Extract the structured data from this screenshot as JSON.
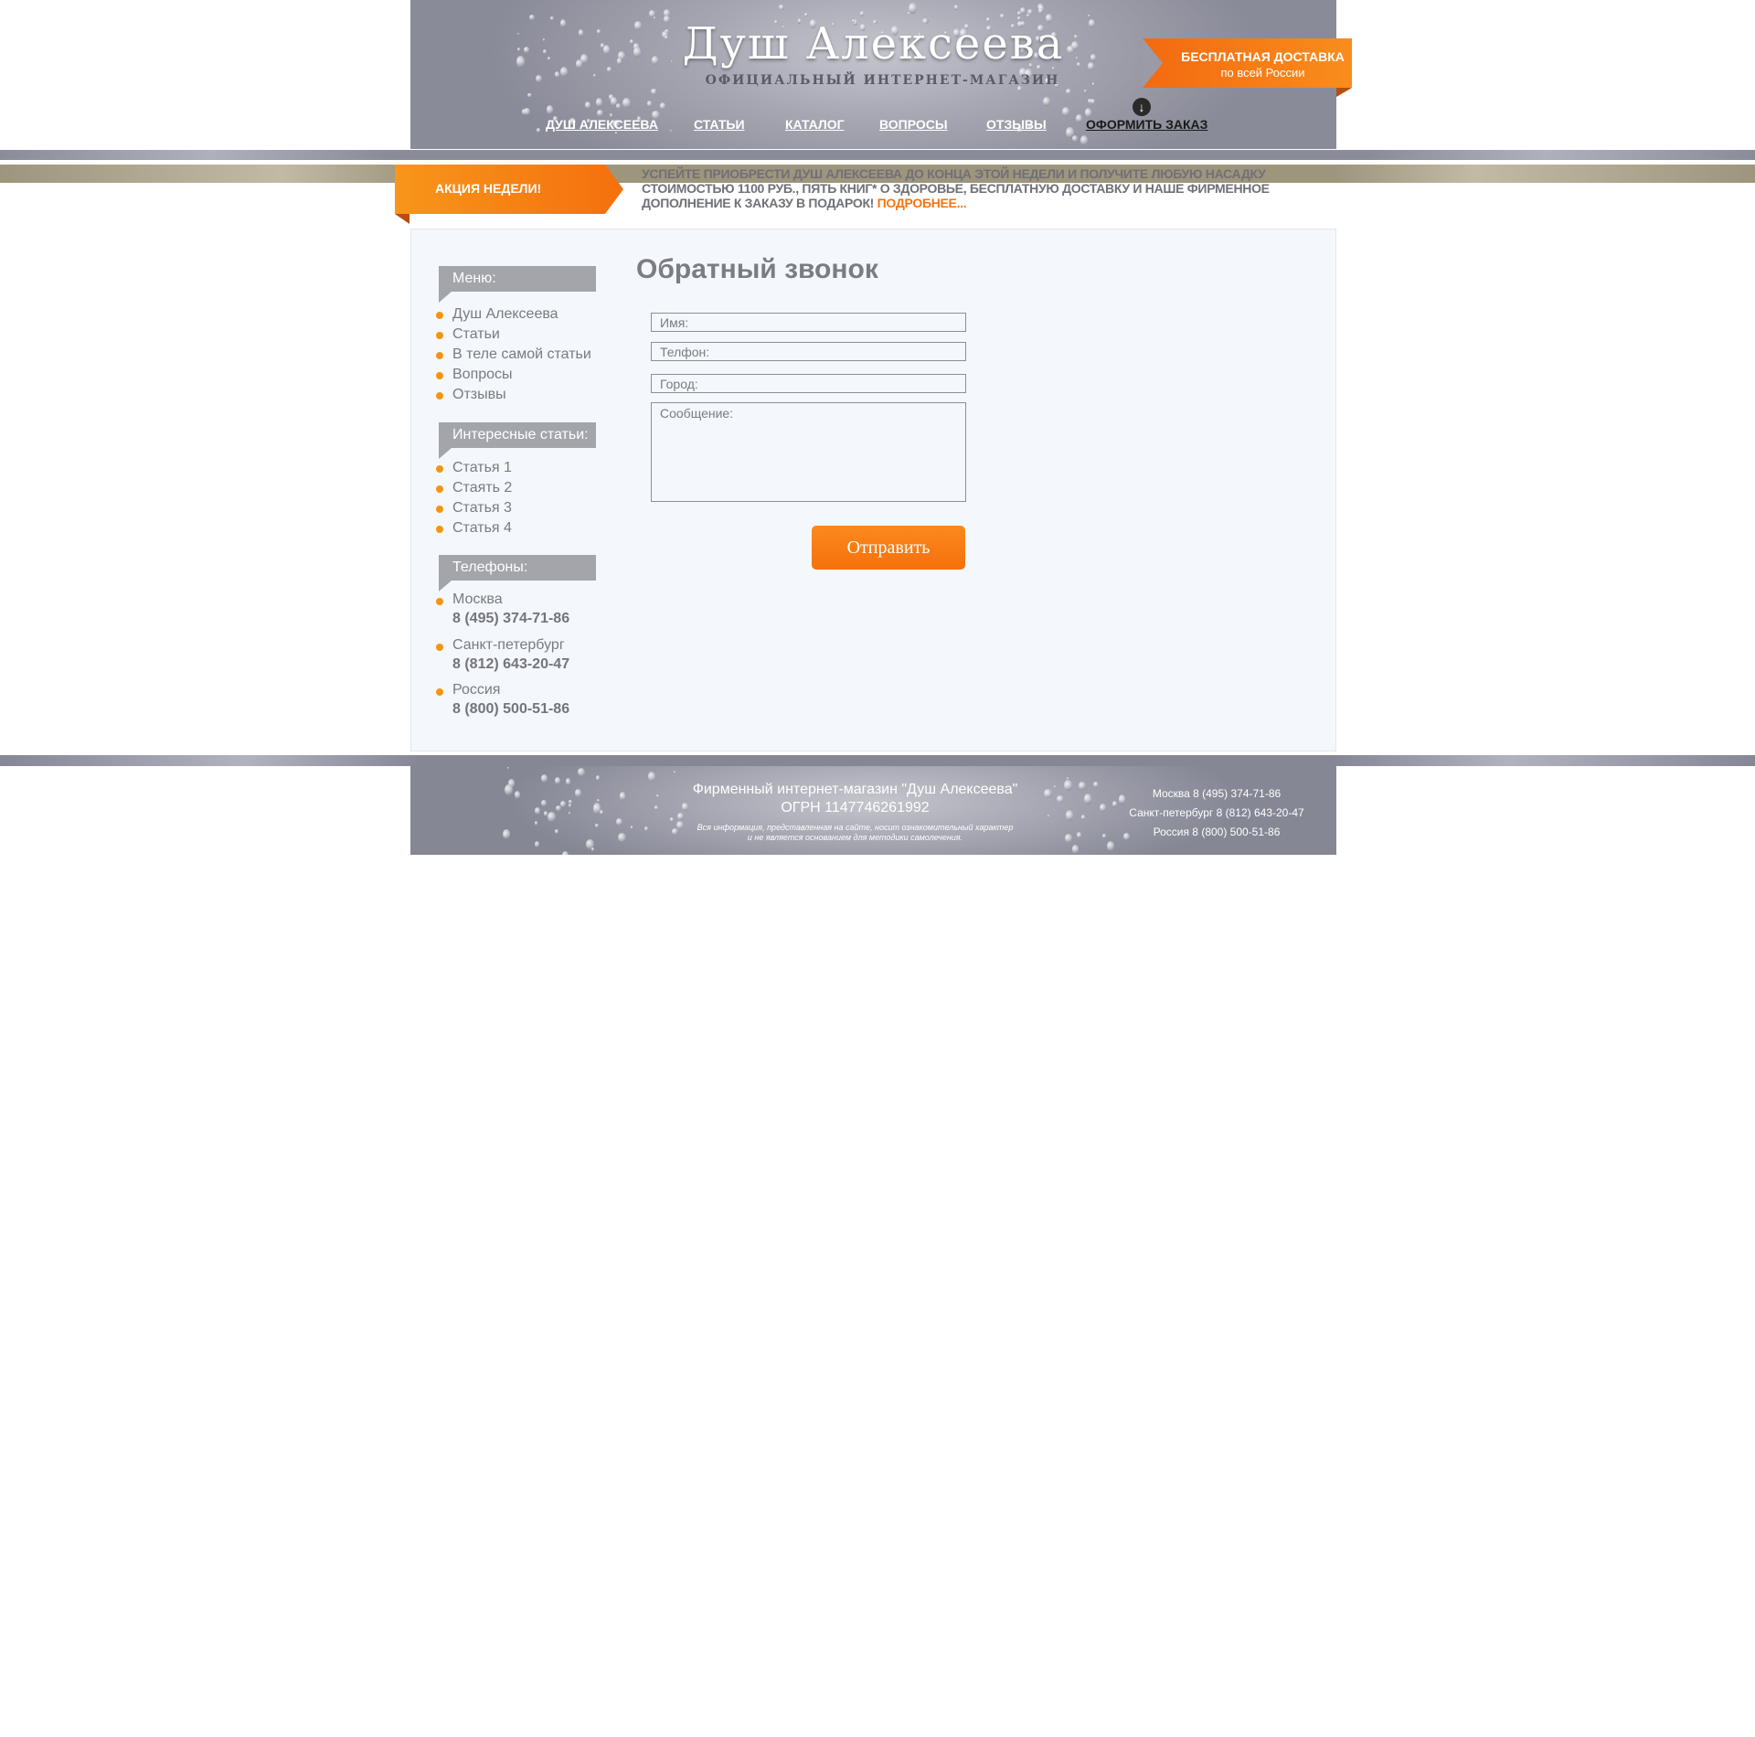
{
  "header": {
    "logo_title": "Душ Алексеева",
    "logo_subtitle": "ОФИЦИАЛЬНЫЙ ИНТЕРНЕТ-МАГАЗИН",
    "nav": [
      {
        "label": "ДУШ АЛЕКСЕЕВА"
      },
      {
        "label": "СТАТЬИ"
      },
      {
        "label": "КАТАЛОГ"
      },
      {
        "label": "ВОПРОСЫ"
      },
      {
        "label": "ОТЗЫВЫ"
      },
      {
        "label": "ОФОРМИТЬ ЗАКАЗ"
      }
    ],
    "order_arrow_icon": "arrow-down-icon",
    "delivery": {
      "line1": "БЕСПЛАТНАЯ ДОСТАВКА",
      "line2": "по всей России"
    }
  },
  "promo": {
    "ribbon_label": "АКЦИЯ НЕДЕЛИ!",
    "text": "УСПЕЙТЕ ПРИОБРЕСТИ ДУШ АЛЕКСЕЕВА ДО КОНЦА ЭТОЙ НЕДЕЛИ И ПОЛУЧИТЕ ЛЮБУЮ НАСАДКУ СТОИМОСТЬЮ 1100 РУБ., ПЯТЬ КНИГ* О ЗДОРОВЬЕ, БЕСПЛАТНУЮ ДОСТАВКУ И НАШЕ ФИРМЕННОЕ ДОПОЛНЕНИЕ К ЗАКАЗУ В ПОДАРОК!",
    "more_link": "ПОДРОБНЕЕ..."
  },
  "sidebar": {
    "menu_title": "Меню:",
    "menu_items": [
      {
        "label": "Душ Алексеева"
      },
      {
        "label": "Статьи"
      },
      {
        "label": "В теле самой статьи"
      },
      {
        "label": "Вопросы"
      },
      {
        "label": "Отзывы"
      }
    ],
    "articles_title": "Интересные статьи:",
    "articles": [
      {
        "label": "Статья 1"
      },
      {
        "label": "Стаять 2"
      },
      {
        "label": "Статья 3"
      },
      {
        "label": "Статья 4"
      }
    ],
    "phones_title": "Телефоны:",
    "phones": [
      {
        "city": "Москва",
        "number": "8 (495) 374-71-86"
      },
      {
        "city": "Санкт-петербург",
        "number": "8 (812) 643-20-47"
      },
      {
        "city": "Россия",
        "number": "8 (800) 500-51-86"
      }
    ]
  },
  "form": {
    "title": "Обратный звонок",
    "name_placeholder": "Имя:",
    "phone_placeholder": "Телфон:",
    "city_placeholder": "Город:",
    "message_placeholder": "Сообщение:",
    "submit_label": "Отправить"
  },
  "footer": {
    "title_line1": "Фирменный интернет-магазин \"Душ Алексеева\"",
    "title_line2": "ОГРН 1147746261992",
    "note_line1": "Вся информация, представленная на сайте, носит ознакомительный характер",
    "note_line2": "и не является основанием для методики самолечения.",
    "phones": [
      "Москва 8 (495) 374-71-86",
      "Санкт-петербург 8 (812) 643-20-47",
      "Россия 8 (800) 500-51-86"
    ]
  },
  "colors": {
    "accent": "#f6720f",
    "header_gray": "#8a8b98",
    "panel_bg": "#f4f7fb",
    "text_gray": "#7a7b82"
  }
}
